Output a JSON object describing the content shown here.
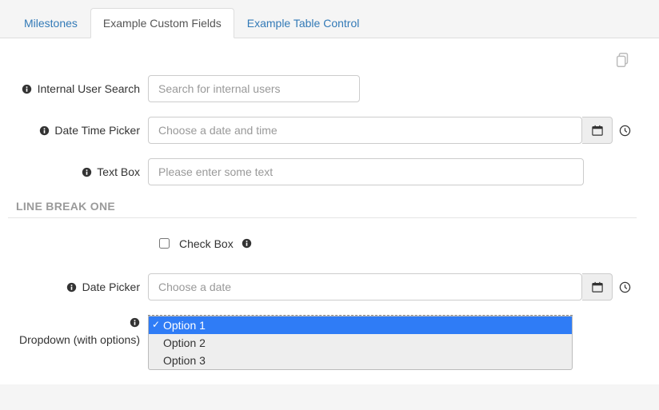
{
  "tabs": {
    "milestones": "Milestones",
    "custom_fields": "Example Custom Fields",
    "table_control": "Example Table Control"
  },
  "fields": {
    "internal_user_search": {
      "label": "Internal User Search",
      "placeholder": "Search for internal users"
    },
    "date_time_picker": {
      "label": "Date Time Picker",
      "placeholder": "Choose a date and time"
    },
    "text_box": {
      "label": "Text Box",
      "placeholder": "Please enter some text"
    },
    "check_box": {
      "label": "Check Box"
    },
    "date_picker": {
      "label": "Date Picker",
      "placeholder": "Choose a date"
    },
    "dropdown": {
      "label": "Dropdown (with options)",
      "options": [
        "Option 1",
        "Option 2",
        "Option 3"
      ]
    }
  },
  "sections": {
    "line_break_one": "LINE BREAK ONE"
  }
}
